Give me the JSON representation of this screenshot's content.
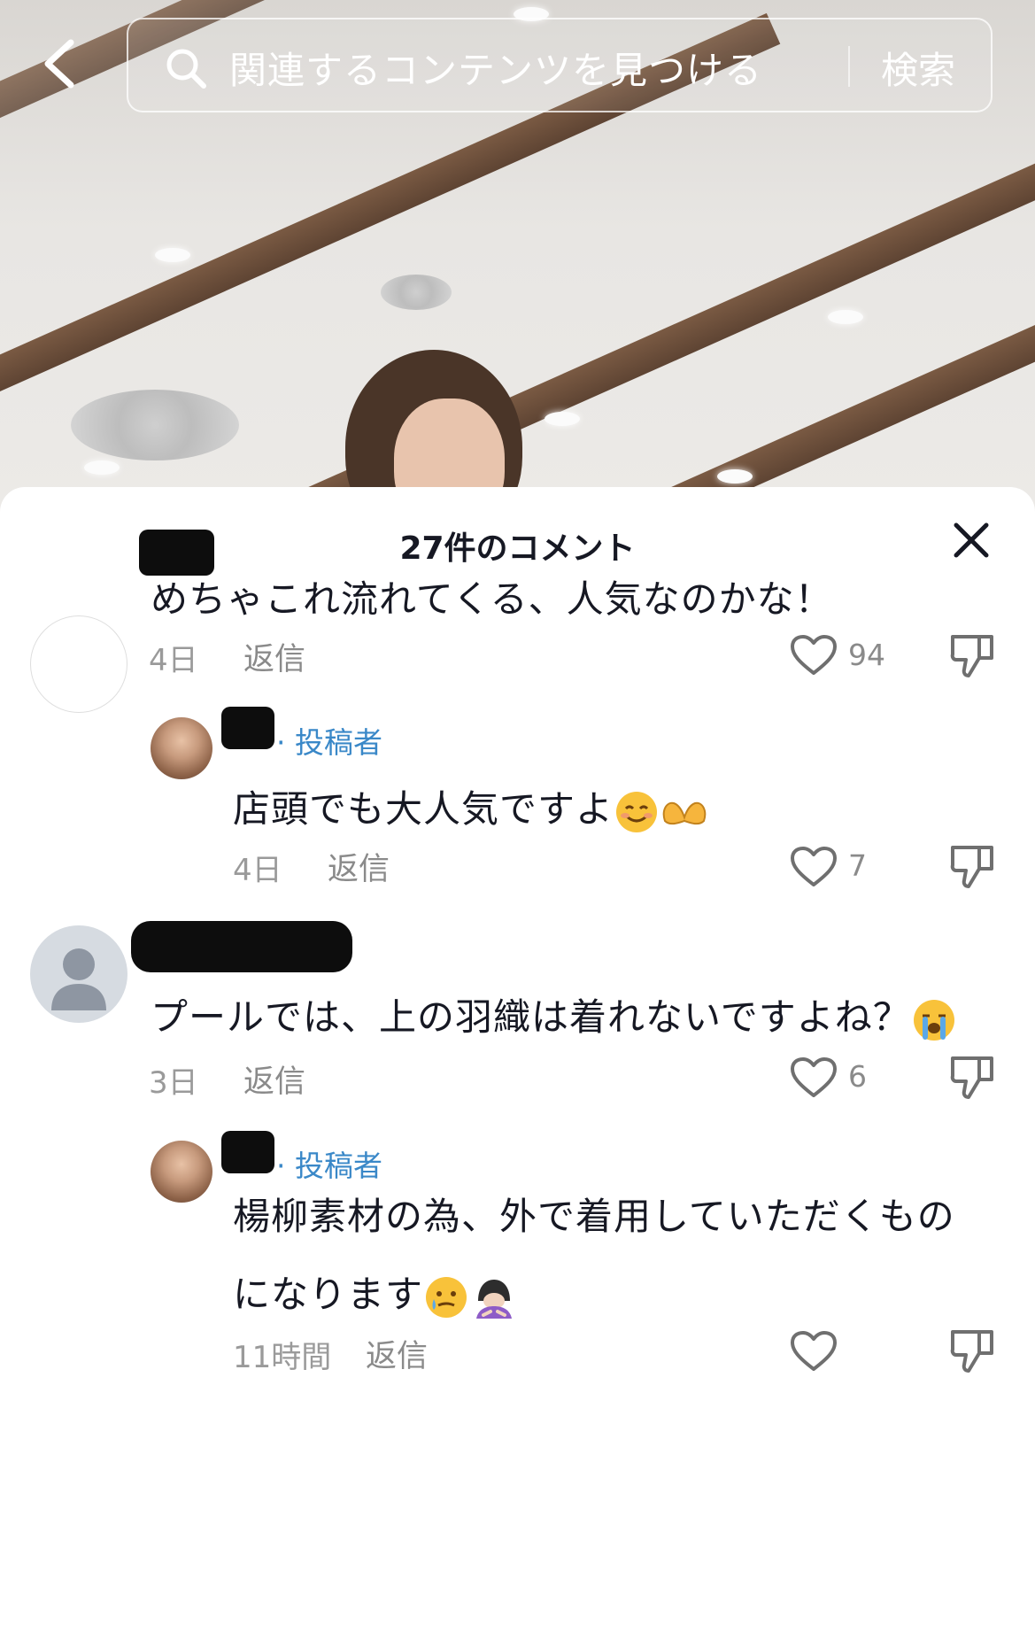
{
  "search": {
    "placeholder": "関連するコンテンツを見つける",
    "button_label": "検索"
  },
  "comments_panel": {
    "title": "27件のコメント",
    "comments": [
      {
        "text": "めちゃこれ流れてくる、人気なのかな！",
        "time": "4日",
        "reply_label": "返信",
        "likes": "94",
        "replies": [
          {
            "author_badge": "· 投稿者",
            "text": "店頭でも大人気ですよ",
            "emojis": [
              "smiling-face-emoji",
              "heart-hands-emoji"
            ],
            "time": "4日",
            "reply_label": "返信",
            "likes": "7"
          }
        ]
      },
      {
        "text": "プールでは、上の羽織は着れないですよね？",
        "emojis": [
          "loudly-crying-emoji"
        ],
        "time": "3日",
        "reply_label": "返信",
        "likes": "6",
        "replies": [
          {
            "author_badge": "· 投稿者",
            "text_line1": "楊柳素材の為、外で着用していただくもの",
            "text_line2": "になります",
            "emojis": [
              "face-holding-back-tears-emoji",
              "person-bowing-emoji"
            ],
            "time": "11時間",
            "reply_label": "返信",
            "likes": ""
          }
        ]
      }
    ]
  },
  "colors": {
    "text_primary": "#161823",
    "text_secondary": "#8a8a8a",
    "author_badge": "#3a88c8",
    "redaction": "#0d0d0d"
  }
}
